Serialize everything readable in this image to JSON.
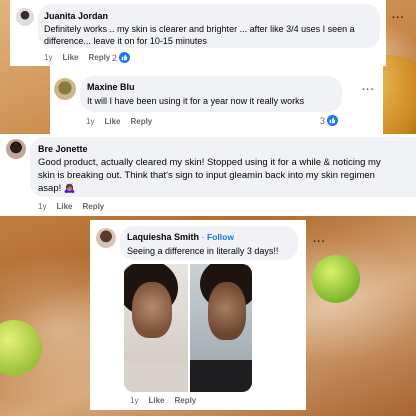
{
  "comments": [
    {
      "author": "Juanita Jordan",
      "text_line1": "Definitely works .. my skin is clearer and brighter ... after like 3/4 uses I seen a",
      "text_line2": "difference... leave it on for 10-15 minutes",
      "time": "1y",
      "like_label": "Like",
      "reply_label": "Reply",
      "reaction_count": "2",
      "more_icon": "more-options-icon"
    },
    {
      "author": "Maxine Blu",
      "text_line1": "It will I have been using it for a year now it really works",
      "time": "1y",
      "like_label": "Like",
      "reply_label": "Reply",
      "reaction_count": "3",
      "more_icon": "more-options-icon"
    },
    {
      "author": "Bre Jonette",
      "text_line1": "Good product, actually cleared my skin! Stopped using it for a while & noticing my",
      "text_line2": "skin is breaking out. Think that's sign to input gleamin back into my skin regimen",
      "text_line3": "asap! 🙇🏽‍♀️",
      "time": "1y",
      "like_label": "Like",
      "reply_label": "Reply"
    },
    {
      "author": "Laquiesha Smith",
      "separator": " · ",
      "follow_label": "Follow",
      "text_line1": "Seeing a difference in literally 3 days!!",
      "time": "1y",
      "like_label": "Like",
      "reply_label": "Reply",
      "more_icon": "more-options-icon"
    }
  ],
  "colors": {
    "bubble": "#f0f2f5",
    "link_blue": "#1877f2",
    "meta_gray": "#65676b"
  }
}
